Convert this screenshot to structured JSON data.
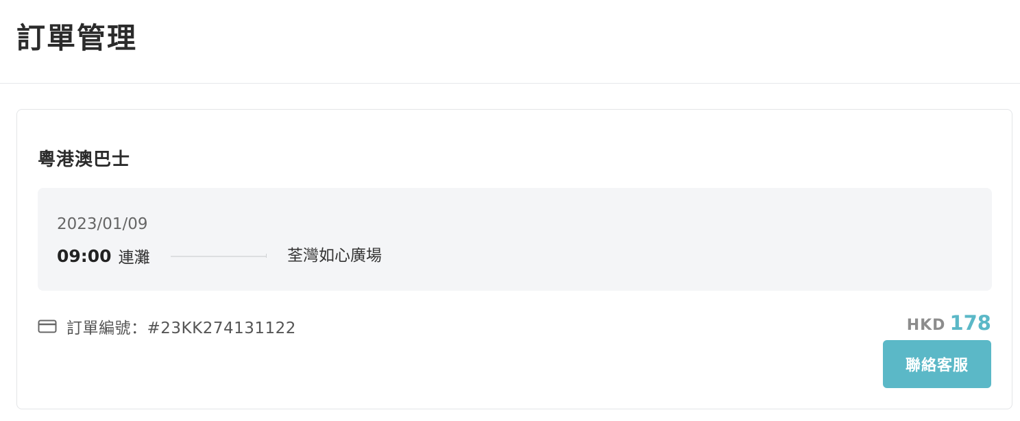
{
  "header": {
    "title": "訂單管理"
  },
  "order": {
    "operator": "粵港澳巴士",
    "trip": {
      "date": "2023/01/09",
      "departure_time": "09:00",
      "departure_place": "連灘",
      "arrival_place": "荃灣如心廣場"
    },
    "order_number_label": "訂單編號：#23KK274131122",
    "order_icon": "credit-card-icon",
    "price": {
      "currency": "HKD",
      "amount": "178"
    },
    "contact_button_label": "聯絡客服"
  },
  "colors": {
    "accent": "#5bb8c7",
    "trip_box_bg": "#f4f5f7",
    "currency_text": "#8c8c8c"
  }
}
